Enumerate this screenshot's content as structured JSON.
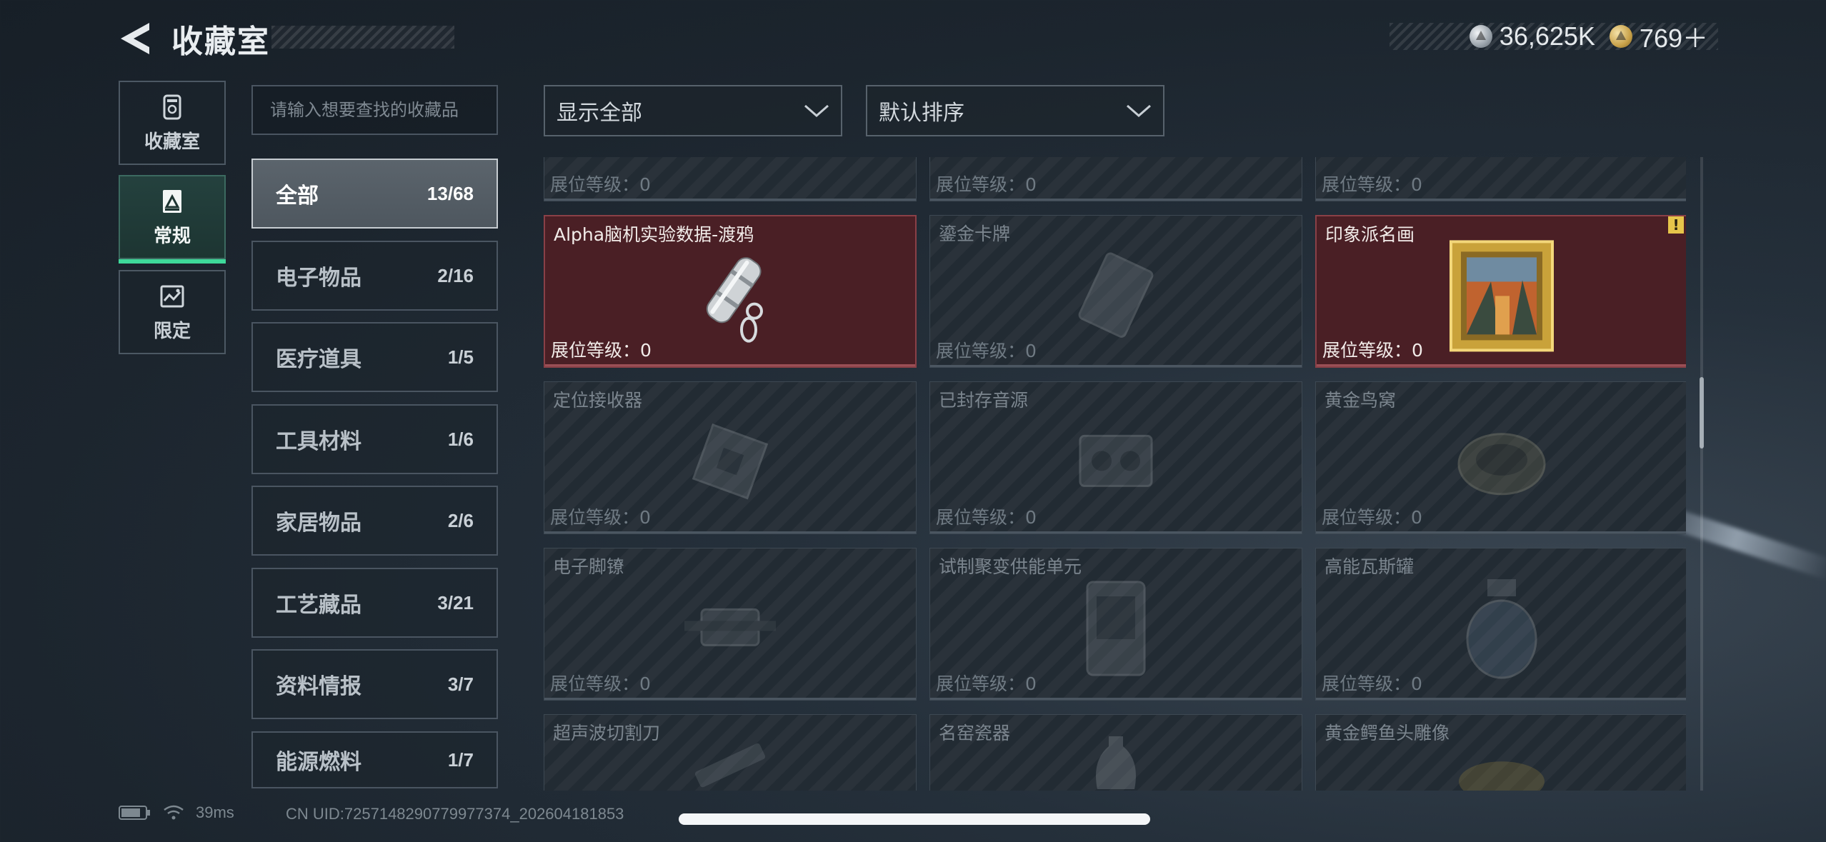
{
  "header": {
    "title": "收藏室"
  },
  "currency": [
    {
      "value": "36,625K",
      "icon": "silver-coin-icon"
    },
    {
      "value": "769＋",
      "icon": "gold-coin-icon"
    }
  ],
  "nav": [
    {
      "label": "收藏室",
      "icon": "vault-icon",
      "active": false
    },
    {
      "label": "常规",
      "icon": "regular-badge-icon",
      "active": true
    },
    {
      "label": "限定",
      "icon": "limited-icon",
      "active": false
    }
  ],
  "search": {
    "placeholder": "请输入想要查找的收藏品"
  },
  "categories": [
    {
      "name": "全部",
      "count": "13/68",
      "active": true
    },
    {
      "name": "电子物品",
      "count": "2/16"
    },
    {
      "name": "医疗道具",
      "count": "1/5"
    },
    {
      "name": "工具材料",
      "count": "1/6"
    },
    {
      "name": "家居物品",
      "count": "2/6"
    },
    {
      "name": "工艺藏品",
      "count": "3/21"
    },
    {
      "name": "资料情报",
      "count": "3/7"
    },
    {
      "name": "能源燃料",
      "count": "1/7"
    }
  ],
  "filters": {
    "display": "显示全部",
    "sort": "默认排序"
  },
  "level_prefix": "展位等级：",
  "items": [
    {
      "name": "",
      "level": "0",
      "owned": false
    },
    {
      "name": "",
      "level": "0",
      "owned": false
    },
    {
      "name": "",
      "level": "0",
      "owned": false
    },
    {
      "name": "Alpha脑机实验数据-渡鸦",
      "level": "0",
      "owned": true,
      "icon": "data-capsule-icon"
    },
    {
      "name": "鎏金卡牌",
      "level": "0",
      "owned": false,
      "icon": "card-icon"
    },
    {
      "name": "印象派名画",
      "level": "0",
      "owned": true,
      "icon": "framed-painting-icon",
      "badge": "!"
    },
    {
      "name": "定位接收器",
      "level": "0",
      "owned": false,
      "icon": "receiver-icon"
    },
    {
      "name": "已封存音源",
      "level": "0",
      "owned": false,
      "icon": "audio-icon"
    },
    {
      "name": "黄金鸟窝",
      "level": "0",
      "owned": false,
      "icon": "nest-icon"
    },
    {
      "name": "电子脚镣",
      "level": "0",
      "owned": false,
      "icon": "ankle-monitor-icon"
    },
    {
      "name": "试制聚变供能单元",
      "level": "0",
      "owned": false,
      "icon": "fusion-cell-icon"
    },
    {
      "name": "高能瓦斯罐",
      "level": "0",
      "owned": false,
      "icon": "gas-canister-icon"
    },
    {
      "name": "超声波切割刀",
      "level": "",
      "owned": false,
      "icon": "cutter-icon"
    },
    {
      "name": "名窑瓷器",
      "level": "",
      "owned": false,
      "icon": "porcelain-icon"
    },
    {
      "name": "黄金鳄鱼头雕像",
      "level": "",
      "owned": false,
      "icon": "croc-statue-icon"
    }
  ],
  "status": {
    "ping": "39ms",
    "uid": "CN UID:7257148290779977374_202604181853"
  },
  "colors": {
    "accent": "#3ed99a",
    "owned_bg": "#4a1f25",
    "badge": "#e6c54a"
  }
}
